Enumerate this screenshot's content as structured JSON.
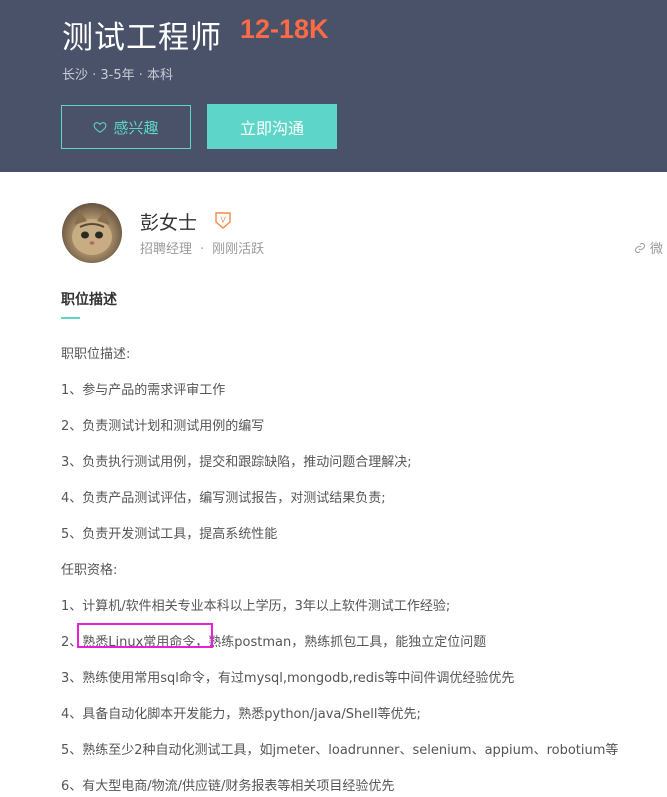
{
  "job": {
    "title": "测试工程师",
    "salary": "12-18K",
    "meta": "长沙 · 3-5年 · 本科"
  },
  "actions": {
    "interest_label": "感兴趣",
    "chat_label": "立即沟通"
  },
  "recruiter": {
    "name": "彭女士",
    "role": "招聘经理",
    "status": "刚刚活跃",
    "share_label": "微"
  },
  "section": {
    "title": "职位描述"
  },
  "description": [
    "职职位描述:",
    "1、参与产品的需求评审工作",
    "2、负责测试计划和测试用例的编写",
    "3、负责执行测试用例，提交和跟踪缺陷，推动问题合理解决;",
    "4、负责产品测试评估，编写测试报告，对测试结果负责;",
    "5、负责开发测试工具，提高系统性能",
    "任职资格:",
    "1、计算机/软件相关专业本科以上学历，3年以上软件测试工作经验;",
    "2、熟悉Linux常用命令，熟练postman，熟练抓包工具，能独立定位问题",
    "3、熟练使用常用sql命令，有过mysql,mongodb,redis等中间件调优经验优先",
    "4、具备自动化脚本开发能力，熟悉python/java/Shell等优先;",
    "5、熟练至少2种自动化测试工具，如jmeter、loadrunner、selenium、appium、robotium等",
    "6、有大型电商/物流/供应链/财务报表等相关项目经验优先"
  ],
  "colors": {
    "header_bg": "#4a5269",
    "salary": "#fc6b45",
    "accent": "#5dd5c8",
    "highlight": "#e91fd8"
  },
  "icons": {
    "interest": "heart-icon",
    "verified": "vip-badge-icon",
    "share": "link-icon"
  }
}
